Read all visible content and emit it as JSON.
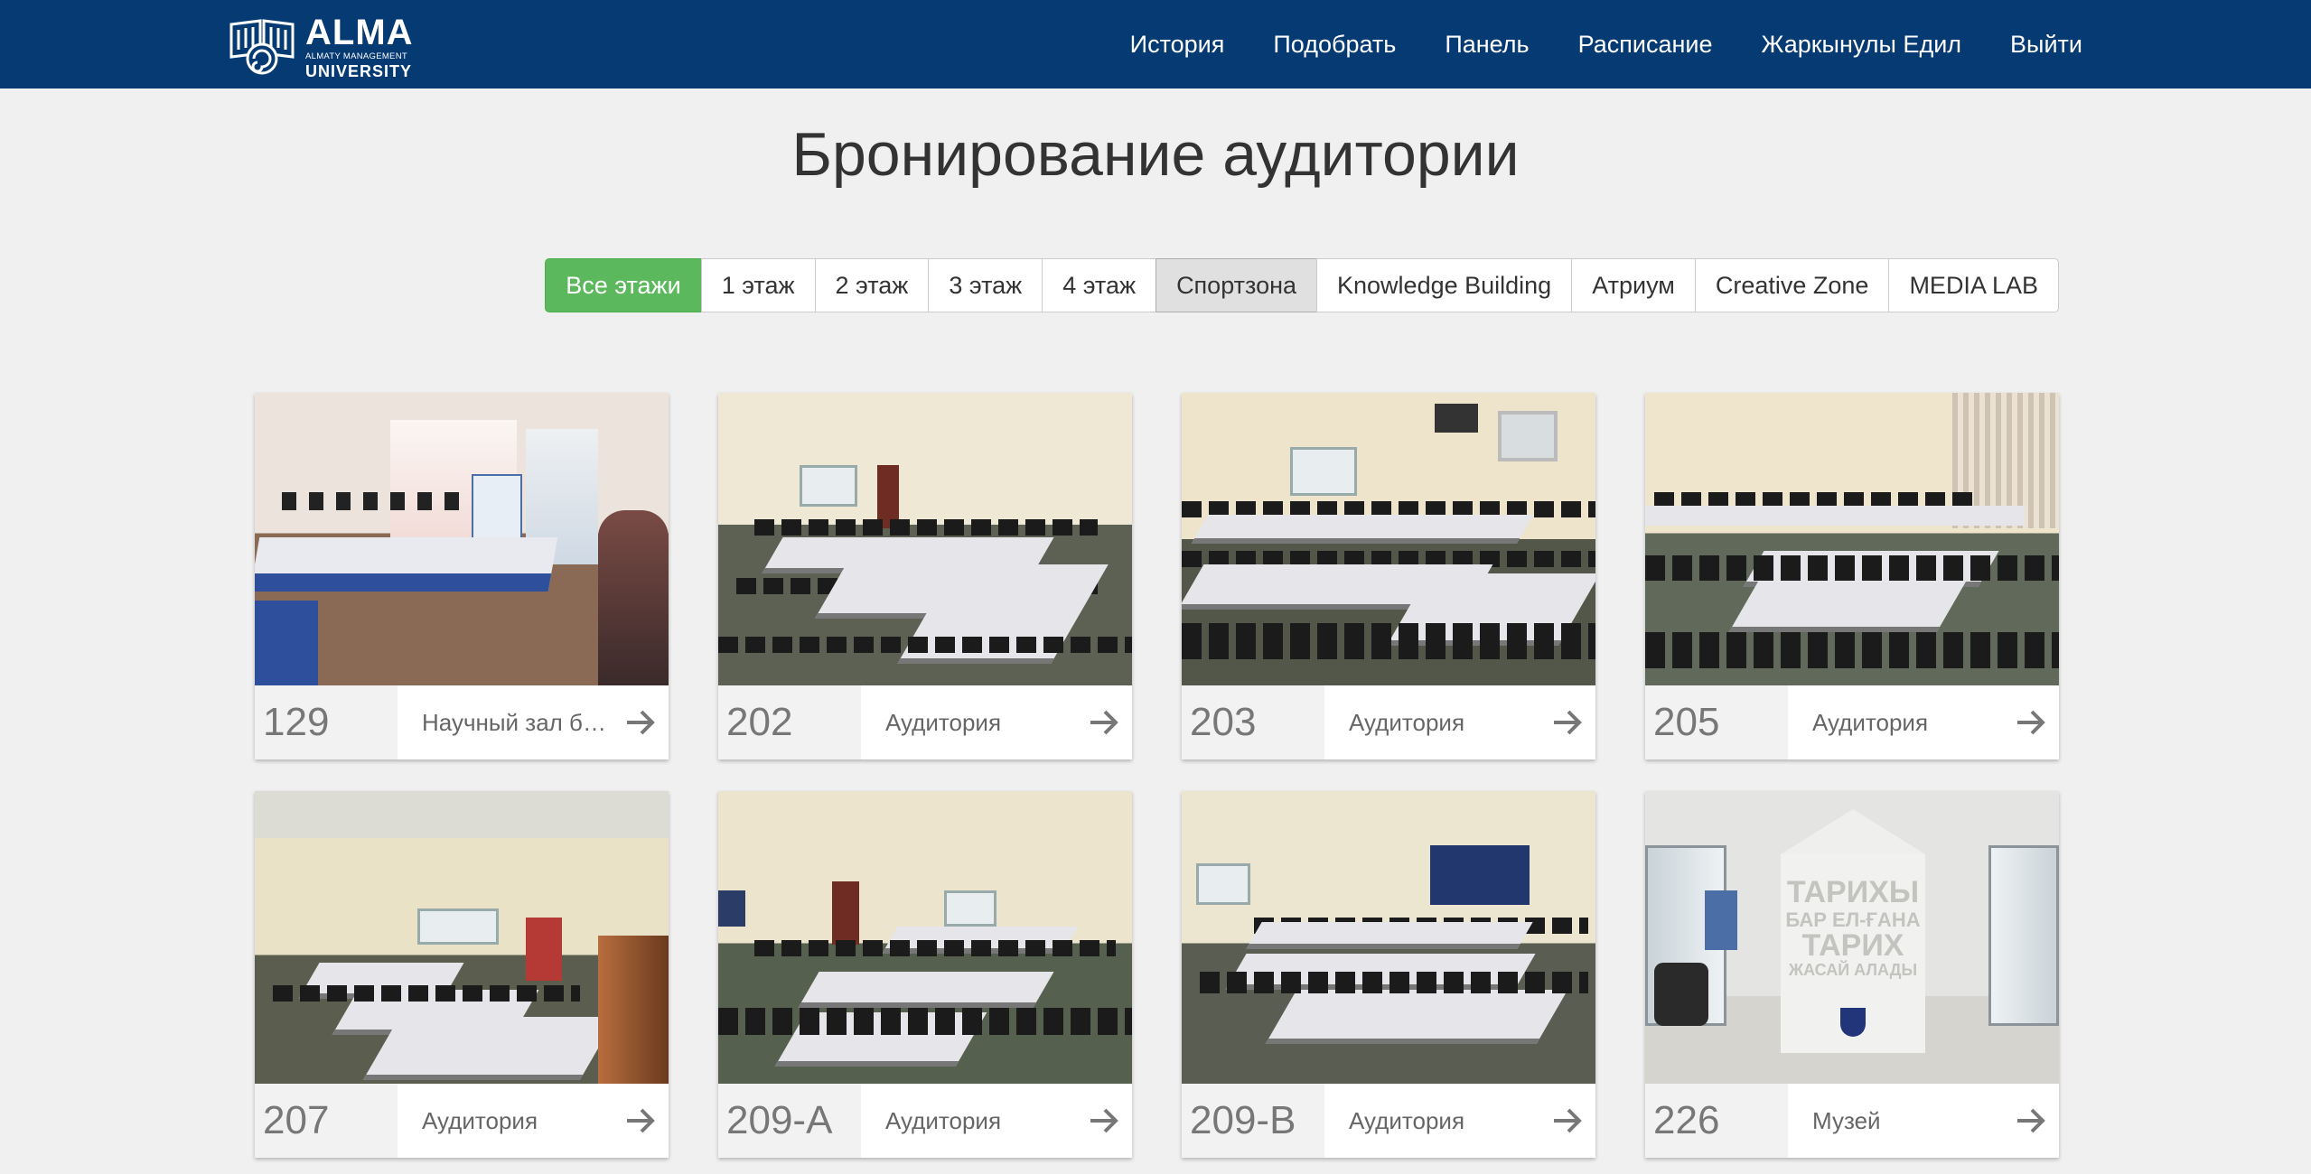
{
  "brand": {
    "name": "ALMA",
    "subtitle": "ALMATY MANAGEMENT",
    "university": "UNIVERSITY"
  },
  "nav": {
    "history": "История",
    "pick": "Подобрать",
    "panel": "Панель",
    "schedule": "Расписание",
    "user": "Жаркынулы Едил",
    "logout": "Выйти"
  },
  "page": {
    "title": "Бронирование аудитории"
  },
  "filters": [
    "Все этажи",
    "1 этаж",
    "2 этаж",
    "3 этаж",
    "4 этаж",
    "Спортзона",
    "Knowledge Building",
    "Атриум",
    "Creative Zone",
    "MEDIA LAB"
  ],
  "rooms": [
    {
      "number": "129",
      "type": "Научный зал библиотеки"
    },
    {
      "number": "202",
      "type": "Аудитория"
    },
    {
      "number": "203",
      "type": "Аудитория"
    },
    {
      "number": "205",
      "type": "Аудитория"
    },
    {
      "number": "207",
      "type": "Аудитория"
    },
    {
      "number": "209-A",
      "type": "Аудитория"
    },
    {
      "number": "209-B",
      "type": "Аудитория"
    },
    {
      "number": "226",
      "type": "Музей"
    }
  ],
  "museum_sign": {
    "line1": "ТАРИХЫ",
    "line2": "БАР ЕЛ-ҒАНА",
    "line3": "ТАРИХ",
    "line4": "ЖАСАЙ АЛАДЫ"
  },
  "colors": {
    "navbar": "#063a73",
    "active_filter": "#5cb85c",
    "background": "#f0f0f0"
  }
}
